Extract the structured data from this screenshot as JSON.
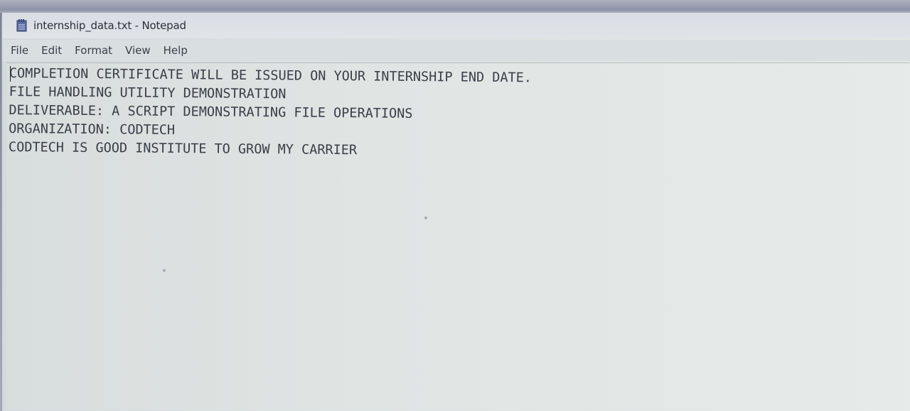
{
  "window": {
    "title": "internship_data.txt - Notepad",
    "app_icon": "notepad-icon"
  },
  "menubar": {
    "items": [
      "File",
      "Edit",
      "Format",
      "View",
      "Help"
    ]
  },
  "document": {
    "lines": [
      "COMPLETION CERTIFICATE WILL BE ISSUED ON YOUR INTERNSHIP END DATE.",
      "FILE HANDLING UTILITY DEMONSTRATION",
      "DELIVERABLE: A SCRIPT DEMONSTRATING FILE OPERATIONS",
      "ORGANIZATION: CODTECH",
      "CODTECH IS GOOD INSTITUTE TO GROW MY CARRIER"
    ]
  },
  "colors": {
    "text": "#3a3e48",
    "background": "#e0e4e3",
    "titlebar": "#dadee4"
  }
}
